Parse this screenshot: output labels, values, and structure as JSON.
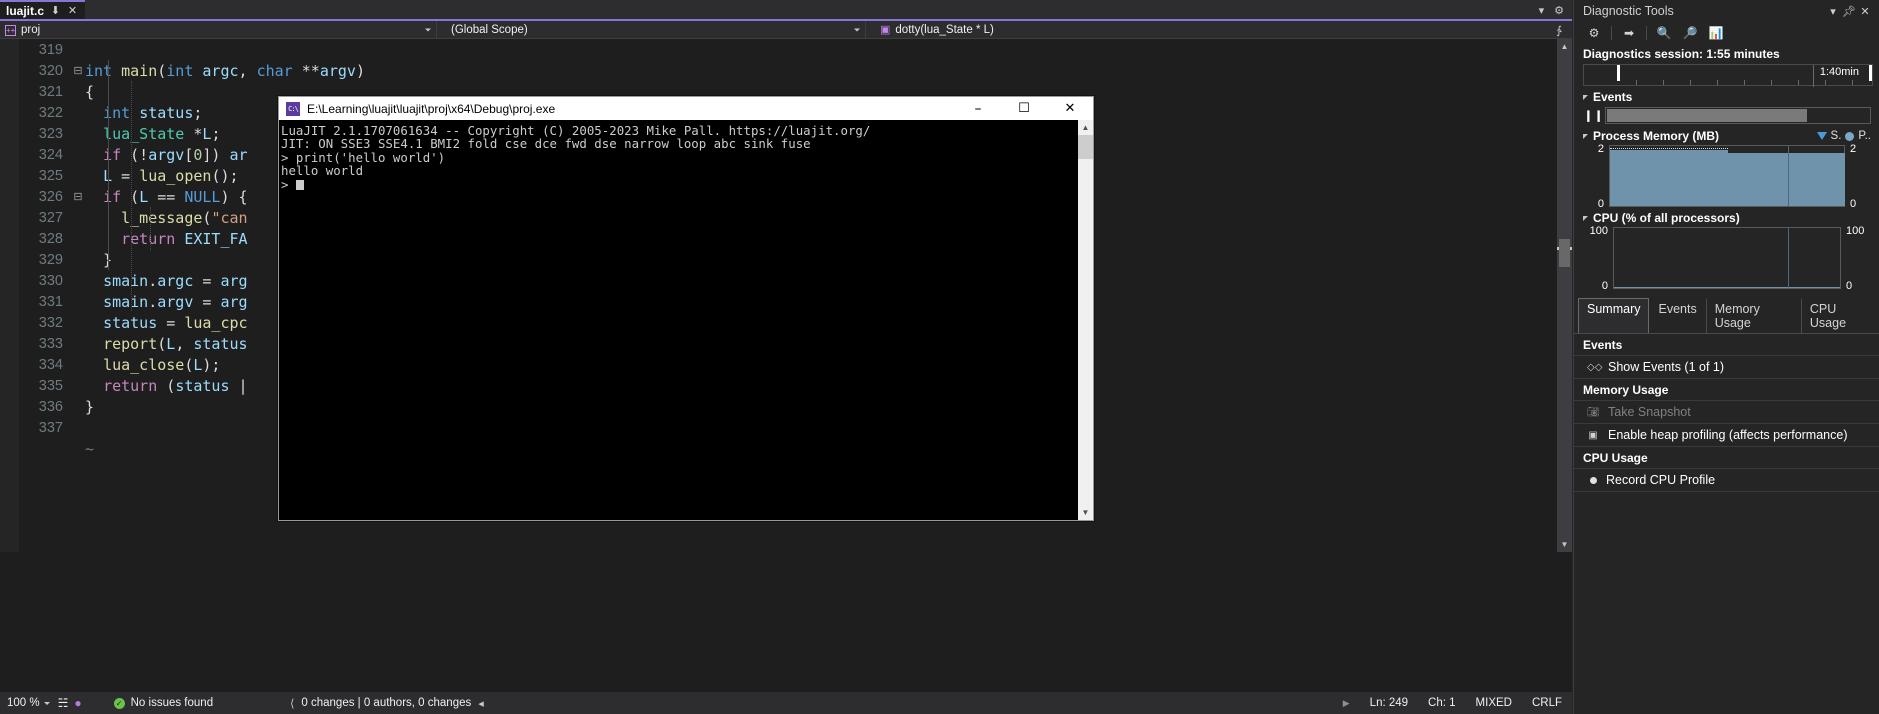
{
  "editor": {
    "tab": {
      "title": "luajit.c",
      "pin_icon": "pin-icon",
      "close_icon": "close-icon"
    },
    "navbar": {
      "project": "proj",
      "scope": "(Global Scope)",
      "member": "dotty(lua_State * L)"
    },
    "code": [
      {
        "num": "319",
        "fold": "",
        "text": ""
      },
      {
        "num": "320",
        "fold": "-",
        "text": "int main(int argc, char **argv)"
      },
      {
        "num": "321",
        "fold": "",
        "text": "{"
      },
      {
        "num": "322",
        "fold": "",
        "text": "  int status;"
      },
      {
        "num": "323",
        "fold": "",
        "text": "  lua_State *L;"
      },
      {
        "num": "324",
        "fold": "",
        "text": "  if (!argv[0]) ar"
      },
      {
        "num": "325",
        "fold": "",
        "text": "  L = lua_open();"
      },
      {
        "num": "326",
        "fold": "-",
        "text": "  if (L == NULL) {"
      },
      {
        "num": "327",
        "fold": "",
        "text": "    l_message(\"can"
      },
      {
        "num": "328",
        "fold": "",
        "text": "    return EXIT_FA"
      },
      {
        "num": "329",
        "fold": "",
        "text": "  }"
      },
      {
        "num": "330",
        "fold": "",
        "text": "  smain.argc = arg"
      },
      {
        "num": "331",
        "fold": "",
        "text": "  smain.argv = arg"
      },
      {
        "num": "332",
        "fold": "",
        "text": "  status = lua_cpc"
      },
      {
        "num": "333",
        "fold": "",
        "text": "  report(L, status"
      },
      {
        "num": "334",
        "fold": "",
        "text": "  lua_close(L);"
      },
      {
        "num": "335",
        "fold": "",
        "text": "  return (status |"
      },
      {
        "num": "336",
        "fold": "",
        "text": "}"
      },
      {
        "num": "337",
        "fold": "",
        "text": ""
      },
      {
        "num": "",
        "fold": "",
        "text": "~"
      }
    ]
  },
  "console": {
    "title": "E:\\Learning\\luajit\\luajit\\proj\\x64\\Debug\\proj.exe",
    "minimize_label": "–",
    "maximize_label": "☐",
    "close_label": "✕",
    "lines": [
      "LuaJIT 2.1.1707061634 -- Copyright (C) 2005-2023 Mike Pall. https://luajit.org/",
      "JIT: ON SSE3 SSE4.1 BMI2 fold cse dce fwd dse narrow loop abc sink fuse",
      "> print('hello world')",
      "hello world",
      ">"
    ]
  },
  "statusbar": {
    "zoom": "100 %",
    "issues": "No issues found",
    "changes": "0 changes | 0 authors, 0 changes",
    "line": "Ln: 249",
    "ch": "Ch: 1",
    "mixed": "MIXED",
    "eol": "CRLF"
  },
  "diagnostics": {
    "title": "Diagnostic Tools",
    "toolbar": [
      "settings-gear",
      "export",
      "zoom-in",
      "zoom-out",
      "chart"
    ],
    "session": "Diagnostics session: 1:55 minutes",
    "timeline_label": "1:40min",
    "events": {
      "title": "Events",
      "pause_icon": "pause-icon"
    },
    "memory": {
      "title": "Process Memory (MB)",
      "legend_snapshot": "S.",
      "legend_private": "P..",
      "axis_max": "2",
      "axis_min": "0"
    },
    "cpu": {
      "title": "CPU (% of all processors)",
      "axis_max": "100",
      "axis_min": "0"
    },
    "tabs": [
      {
        "label": "Summary",
        "active": true
      },
      {
        "label": "Events",
        "active": false
      },
      {
        "label": "Memory Usage",
        "active": false
      },
      {
        "label": "CPU Usage",
        "active": false
      }
    ],
    "summary": {
      "events_head": "Events",
      "show_events": "Show Events (1 of 1)",
      "memory_head": "Memory Usage",
      "take_snapshot": "Take Snapshot",
      "heap_profiling": "Enable heap profiling (affects performance)",
      "cpu_head": "CPU Usage",
      "record_cpu": "Record CPU Profile"
    }
  },
  "chart_data": [
    {
      "type": "area",
      "title": "Process Memory (MB)",
      "ylabel": "MB",
      "ylim": [
        0,
        2
      ],
      "xlabel": "",
      "grid": false,
      "legend": [
        "S.",
        "P.."
      ],
      "x": [
        0,
        10,
        20,
        30,
        40,
        50,
        60,
        70,
        80,
        90,
        100
      ],
      "values": [
        2.0,
        2.0,
        2.0,
        2.0,
        2.0,
        2.0,
        1.92,
        1.92,
        1.92,
        1.92,
        1.92
      ]
    },
    {
      "type": "area",
      "title": "CPU (% of all processors)",
      "ylabel": "%",
      "ylim": [
        0,
        100
      ],
      "xlabel": "",
      "grid": false,
      "x": [
        0,
        10,
        20,
        30,
        40,
        50,
        60,
        70,
        80,
        90,
        100
      ],
      "values": [
        0,
        0,
        0,
        0,
        0,
        0,
        0,
        0,
        0,
        0,
        0
      ]
    }
  ]
}
